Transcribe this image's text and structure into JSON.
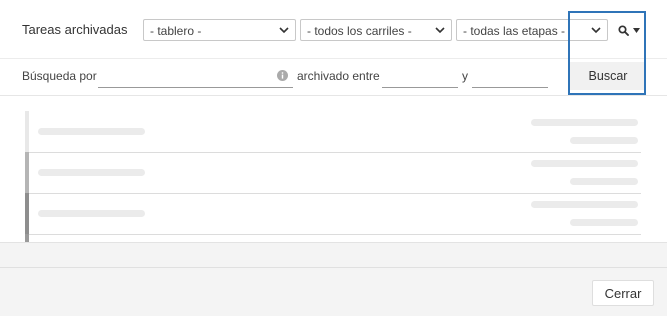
{
  "header": {
    "title": "Tareas archivadas",
    "board_select": {
      "value": "- tablero -"
    },
    "lanes_select": {
      "value": "- todos los carriles -"
    },
    "stages_select": {
      "value": "- todas las etapas -"
    }
  },
  "search": {
    "search_by_label": "Búsqueda por",
    "archived_between_label": "archivado entre",
    "and_label": "y",
    "search_value": "",
    "from_value": "",
    "to_value": "",
    "search_button": "Buscar"
  },
  "results": {
    "rows": [
      {
        "bar_color": "#e8e8e8"
      },
      {
        "bar_color": "#b5b5b5"
      },
      {
        "bar_color": "#8e8e8e"
      },
      {
        "bar_color": "#9a9a9a"
      }
    ]
  },
  "footer": {
    "close_button": "Cerrar"
  },
  "colors": {
    "focus_outline": "#2f74b8"
  },
  "icons": {
    "select_chevron": "chevron-down-icon",
    "search_toggle": "search-icon",
    "dropdown_caret": "caret-down-icon",
    "info": "info-icon"
  }
}
